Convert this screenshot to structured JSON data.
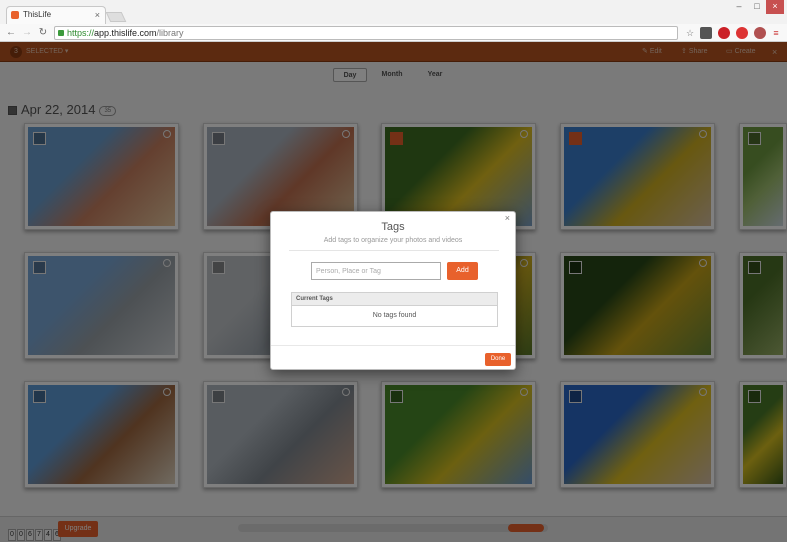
{
  "browser": {
    "tab_title": "ThisLife",
    "tab_close": "×",
    "url_scheme": "https://",
    "url_host": "app.thislife.com",
    "url_path": "/library",
    "window_min": "–",
    "window_max": "□",
    "window_close": "×",
    "nav_back": "←",
    "nav_forward": "→",
    "nav_reload": "↻",
    "star_glyph": "☆",
    "menu_glyph": "≡"
  },
  "app_toolbar": {
    "selected_count": "3",
    "selected_label": "SELECTED ▾",
    "edit_label": "Edit",
    "share_label": "Share",
    "create_label": "Create",
    "close_glyph": "×"
  },
  "view_tabs": {
    "day": "Day",
    "month": "Month",
    "year": "Year",
    "active": "Day"
  },
  "group": {
    "date": "Apr 22, 2014",
    "count": "35"
  },
  "photos": [
    {
      "colors": [
        "#6a9fd0",
        "#c98060",
        "#e9c9a0"
      ],
      "selected": false
    },
    {
      "colors": [
        "#aab4c0",
        "#c07050",
        "#e0c8a0"
      ],
      "selected": false
    },
    {
      "colors": [
        "#3f6e22",
        "#e0c020",
        "#7aa0c8"
      ],
      "selected": true
    },
    {
      "colors": [
        "#3a7fcf",
        "#d0b020",
        "#d8c0a0"
      ],
      "selected": true
    },
    {
      "colors": [
        "#6e9a40",
        "#a0c070",
        "#cbd8e0"
      ],
      "selected": false
    },
    {
      "colors": [
        "#7aa8d8",
        "#9aa2a8",
        "#d0d4d8"
      ],
      "selected": false
    },
    {
      "colors": [
        "#c0c4c8",
        "#a0a8b0",
        "#d8dce0"
      ],
      "selected": false
    },
    {
      "colors": [
        "#2f4a20",
        "#d0b020",
        "#5a7a2a"
      ],
      "selected": false
    },
    {
      "colors": [
        "#284818",
        "#c8a418",
        "#6a8a38"
      ],
      "selected": false
    },
    {
      "colors": [
        "#4d7028",
        "#6a8840",
        "#9ab068"
      ],
      "selected": false
    },
    {
      "colors": [
        "#5f9cd8",
        "#a06840",
        "#e0d4c0"
      ],
      "selected": false
    },
    {
      "colors": [
        "#b0b8c0",
        "#808890",
        "#d0a890"
      ],
      "selected": false
    },
    {
      "colors": [
        "#4a8a2a",
        "#d8c020",
        "#6a9ad0"
      ],
      "selected": false
    },
    {
      "colors": [
        "#2a68c8",
        "#e0c020",
        "#d8c0a8"
      ],
      "selected": false
    },
    {
      "colors": [
        "#4a7a28",
        "#d8c020",
        "#3a5a18"
      ],
      "selected": false
    }
  ],
  "tags_dialog": {
    "title": "Tags",
    "subtitle": "Add tags to organize your photos and videos",
    "input_placeholder": "Person, Place or Tag",
    "add_label": "Add",
    "current_tags_header": "Current Tags",
    "empty_text": "No tags found",
    "done_label": "Done",
    "close_glyph": "×"
  },
  "footer": {
    "counter_digits": [
      "0",
      "0",
      "6",
      "7",
      "4",
      "6"
    ],
    "upgrade_label": "Upgrade"
  },
  "colors": {
    "accent": "#e8612c",
    "toolbar": "#b85420"
  }
}
